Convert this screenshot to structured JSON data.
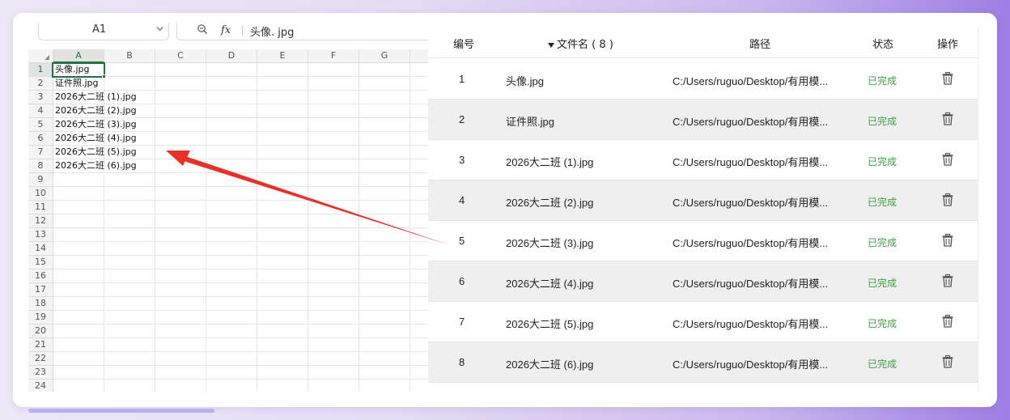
{
  "formula_bar": {
    "cell_ref": "A1",
    "formula_value": "头像. jpg",
    "fx_label": "fx"
  },
  "sheet": {
    "columns": [
      "A",
      "B",
      "C",
      "D",
      "E",
      "F",
      "G"
    ],
    "rows": [
      {
        "num": "1",
        "a": "头像.jpg"
      },
      {
        "num": "2",
        "a": "证件照.jpg"
      },
      {
        "num": "3",
        "a": "2026大二班 (1).jpg"
      },
      {
        "num": "4",
        "a": "2026大二班 (2).jpg"
      },
      {
        "num": "5",
        "a": "2026大二班 (3).jpg"
      },
      {
        "num": "6",
        "a": "2026大二班 (4).jpg"
      },
      {
        "num": "7",
        "a": "2026大二班 (5).jpg"
      },
      {
        "num": "8",
        "a": "2026大二班 (6).jpg"
      },
      {
        "num": "9",
        "a": ""
      },
      {
        "num": "10",
        "a": ""
      },
      {
        "num": "11",
        "a": ""
      },
      {
        "num": "12",
        "a": ""
      },
      {
        "num": "13",
        "a": ""
      },
      {
        "num": "14",
        "a": ""
      },
      {
        "num": "15",
        "a": ""
      },
      {
        "num": "16",
        "a": ""
      },
      {
        "num": "17",
        "a": ""
      },
      {
        "num": "18",
        "a": ""
      },
      {
        "num": "19",
        "a": ""
      },
      {
        "num": "20",
        "a": ""
      },
      {
        "num": "21",
        "a": ""
      },
      {
        "num": "22",
        "a": ""
      },
      {
        "num": "23",
        "a": ""
      },
      {
        "num": "24",
        "a": ""
      }
    ]
  },
  "file_table": {
    "headers": {
      "num": "编号",
      "name": "文件名 ( 8 )",
      "path": "路径",
      "status": "状态",
      "action": "操作"
    },
    "rows": [
      {
        "num": "1",
        "name": "头像.jpg",
        "path": "C:/Users/ruguo/Desktop/有用模...",
        "status": "已完成"
      },
      {
        "num": "2",
        "name": "证件照.jpg",
        "path": "C:/Users/ruguo/Desktop/有用模...",
        "status": "已完成"
      },
      {
        "num": "3",
        "name": "2026大二班 (1).jpg",
        "path": "C:/Users/ruguo/Desktop/有用模...",
        "status": "已完成"
      },
      {
        "num": "4",
        "name": "2026大二班 (2).jpg",
        "path": "C:/Users/ruguo/Desktop/有用模...",
        "status": "已完成"
      },
      {
        "num": "5",
        "name": "2026大二班 (3).jpg",
        "path": "C:/Users/ruguo/Desktop/有用模...",
        "status": "已完成"
      },
      {
        "num": "6",
        "name": "2026大二班 (4).jpg",
        "path": "C:/Users/ruguo/Desktop/有用模...",
        "status": "已完成"
      },
      {
        "num": "7",
        "name": "2026大二班 (5).jpg",
        "path": "C:/Users/ruguo/Desktop/有用模...",
        "status": "已完成"
      },
      {
        "num": "8",
        "name": "2026大二班 (6).jpg",
        "path": "C:/Users/ruguo/Desktop/有用模...",
        "status": "已完成"
      }
    ],
    "action_icon": "trash-icon"
  },
  "colors": {
    "excel_green": "#217346",
    "status_green": "#3aa043",
    "arrow_red": "#e8312a",
    "alt_row": "#efefef"
  }
}
